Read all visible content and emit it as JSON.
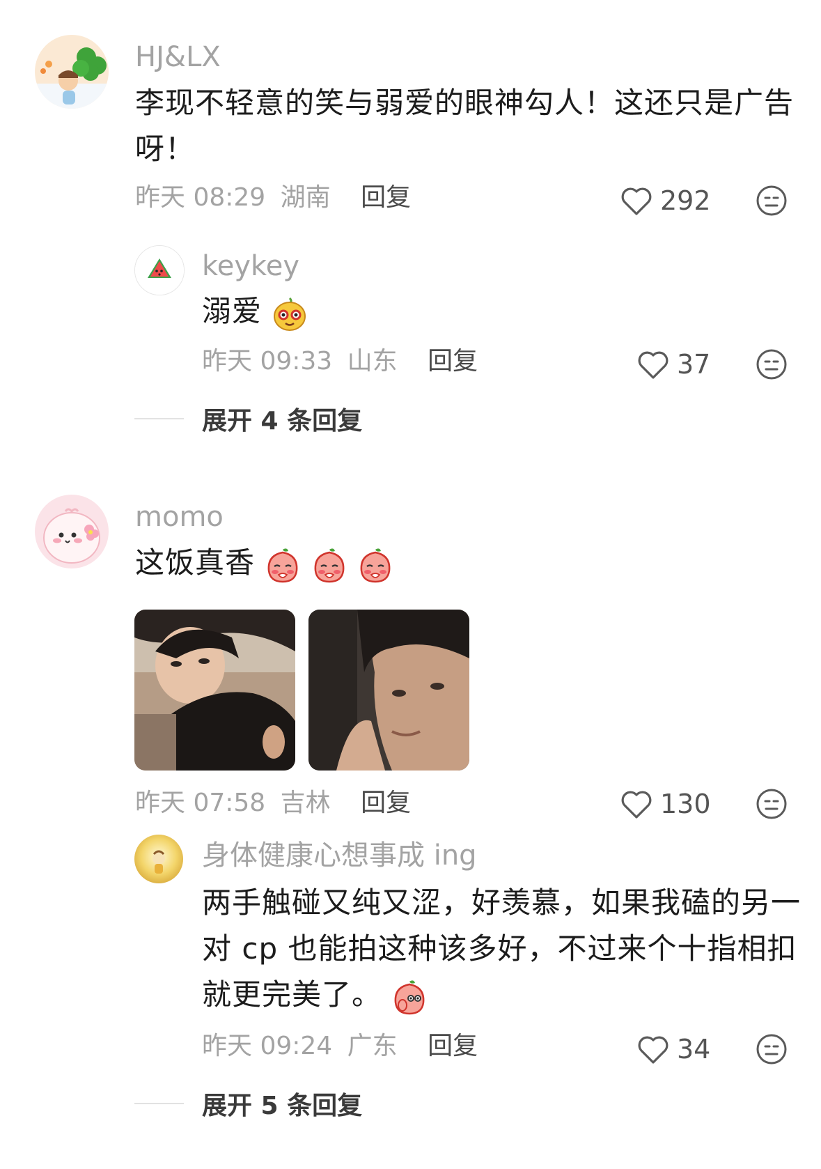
{
  "comments": [
    {
      "username": "HJ&LX",
      "text_line1": "李现不轻意的笑与弱爱的眼神勾人！这还只是广告",
      "text_line2": "呀！",
      "date": "昨天 08:29",
      "location": "湖南",
      "reply_label": "回复",
      "likes": "292",
      "replies": [
        {
          "username": "keykey",
          "text": "溺爱",
          "date": "昨天 09:33",
          "location": "山东",
          "reply_label": "回复",
          "likes": "37"
        }
      ],
      "expand_label": "展开 4 条回复"
    },
    {
      "username": "momo",
      "text": "这饭真香",
      "date": "昨天 07:58",
      "location": "吉林",
      "reply_label": "回复",
      "likes": "130",
      "replies": [
        {
          "username": "身体健康心想事成 ing",
          "text_line1": "两手触碰又纯又涩，好羡慕，如果我磕的另一",
          "text_line2": "对 cp 也能拍这种该多好，不过来个十指相扣",
          "text_line3": "就更完美了。",
          "date": "昨天 09:24",
          "location": "广东",
          "reply_label": "回复",
          "likes": "34"
        }
      ],
      "expand_label": "展开 5 条回复"
    }
  ]
}
